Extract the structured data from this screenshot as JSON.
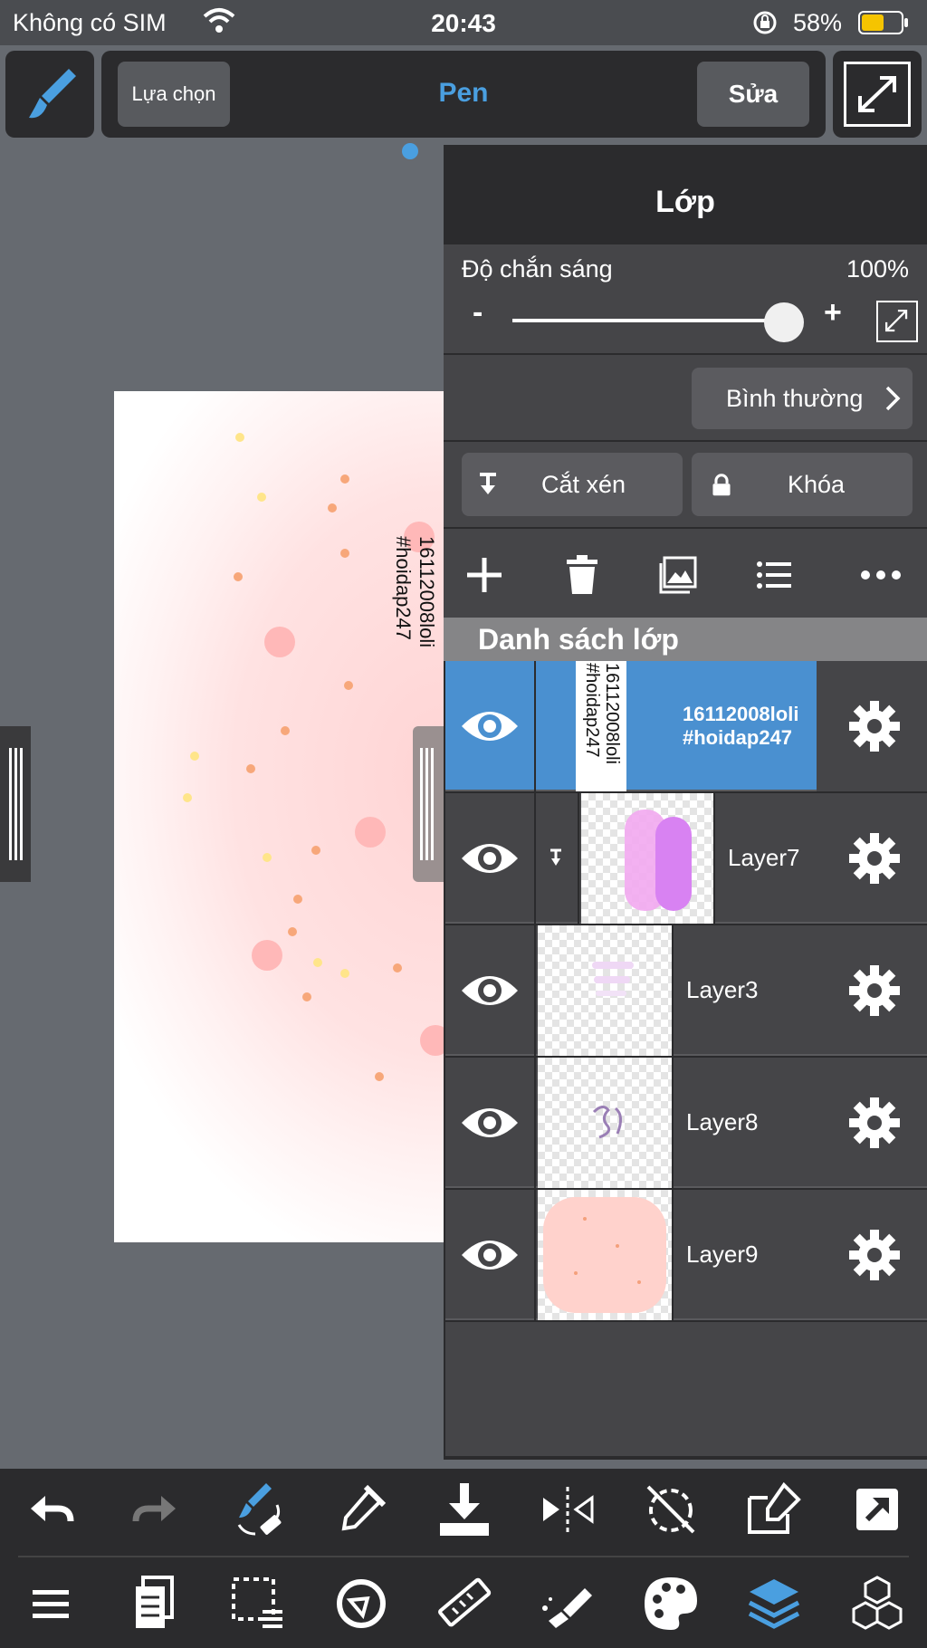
{
  "status_bar": {
    "carrier": "Không có SIM",
    "time": "20:43",
    "battery": "58%",
    "battery_level": 0.58
  },
  "toolbar": {
    "select_label": "Lựa chọn",
    "tool_name": "Pen",
    "edit_label": "Sửa"
  },
  "layer_panel": {
    "title": "Lớp",
    "opacity_label": "Độ chắn sáng",
    "opacity_value": "100%",
    "opacity_fraction": 1.0,
    "minus": "-",
    "plus": "+",
    "blend_mode": "Bình thường",
    "clip_label": "Cắt xén",
    "lock_label": "Khóa",
    "list_header": "Danh sách lớp",
    "layers": [
      {
        "name": "16112008loli\n#hoidap247",
        "line1": "16112008loli",
        "line2": "#hoidap247",
        "selected": true,
        "clipped": false
      },
      {
        "name": "Layer7",
        "selected": false,
        "clipped": true
      },
      {
        "name": "Layer3",
        "selected": false,
        "clipped": false
      },
      {
        "name": "Layer8",
        "selected": false,
        "clipped": false
      },
      {
        "name": "Layer9",
        "selected": false,
        "clipped": false
      }
    ]
  },
  "canvas": {
    "text_line1": "16112008loli",
    "text_line2": "#hoidap247"
  },
  "colors": {
    "accent": "#4a9fe0",
    "selected_layer": "#4a90d0",
    "panel_bg": "#2b2b2d",
    "section_bg": "#454548"
  },
  "icons": {
    "top": [
      "brush-icon",
      "fullscreen-icon"
    ],
    "layer_actions": [
      "add-layer-icon",
      "trash-icon",
      "image-icon",
      "list-icon",
      "more-icon"
    ],
    "bottom_row1": [
      "undo-icon",
      "redo-icon",
      "brush-eraser-swap-icon",
      "eyedropper-icon",
      "download-icon",
      "flip-icon",
      "rotate-reset-icon",
      "transform-edit-icon",
      "share-icon"
    ],
    "bottom_row2": [
      "menu-icon",
      "pages-icon",
      "selection-icon",
      "snap-icon",
      "ruler-icon",
      "fill-icon",
      "palette-icon",
      "layers-icon",
      "materials-icon"
    ]
  }
}
